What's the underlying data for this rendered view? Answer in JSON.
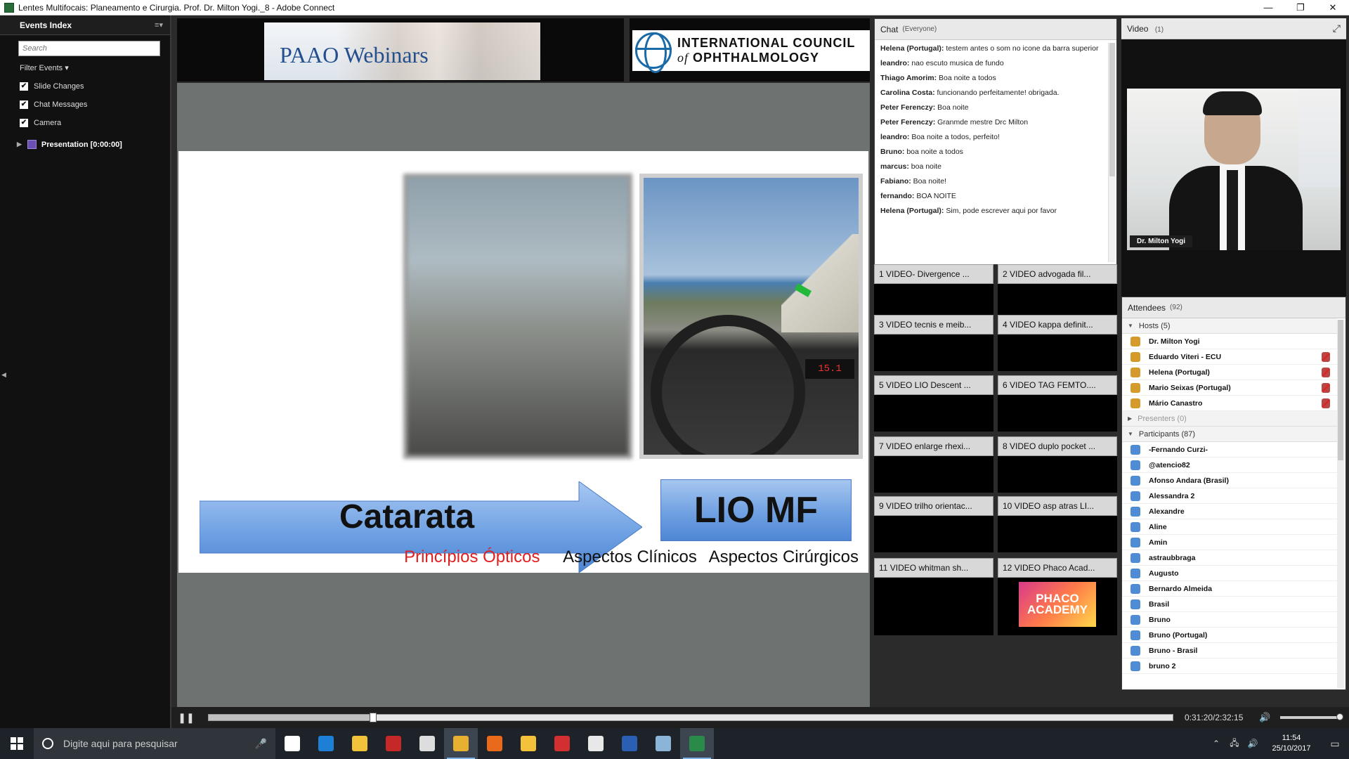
{
  "window": {
    "title": "Lentes Multifocais: Planeamento e Cirurgia. Prof. Dr. Milton Yogi._8 - Adobe Connect",
    "minimize": "—",
    "maximize": "❐",
    "close": "✕"
  },
  "events": {
    "title": "Events Index",
    "menu_icon": "≡▾",
    "search_placeholder": "Search",
    "filter_label": "Filter Events",
    "filter_caret": "▾",
    "checks": [
      "Slide Changes",
      "Chat Messages",
      "Camera"
    ],
    "check_mark": "✔",
    "tree_arrow": "▶",
    "presentation_label": "Presentation [0:00:00]",
    "collapse_arrow": "◀"
  },
  "logos": {
    "paao_text": "PAAO Webinars",
    "icoph_line1": "INTERNATIONAL COUNCIL",
    "icoph_of": "of",
    "icoph_line2": "OPHTHALMOLOGY"
  },
  "slide": {
    "dash_display": "15.1",
    "catarata": "Catarata",
    "lio": "LIO MF",
    "footer": {
      "optical": "Princípios Ópticos",
      "clinical": "Aspectos Clínicos",
      "surgical": "Aspectos Cirúrgicos"
    },
    "accent_red": "#e02020",
    "arrow_color": "#5b92dc"
  },
  "chat": {
    "title": "Chat",
    "scope": "(Everyone)",
    "messages": [
      {
        "from": "Helena (Portugal):",
        "text": "testem antes o som no icone da barra superior"
      },
      {
        "from": "leandro:",
        "text": "nao escuto musica de fundo"
      },
      {
        "from": "Thiago Amorim:",
        "text": "Boa noite a todos"
      },
      {
        "from": "Carolina Costa:",
        "text": "funcionando perfeitamente! obrigada."
      },
      {
        "from": "Peter Ferenczy:",
        "text": "Boa noite"
      },
      {
        "from": "Peter Ferenczy:",
        "text": "Granmde mestre Drc Milton"
      },
      {
        "from": "leandro:",
        "text": "Boa noite a todos, perfeito!"
      },
      {
        "from": "Bruno:",
        "text": "boa noite a todos"
      },
      {
        "from": "marcus:",
        "text": "boa noite"
      },
      {
        "from": "Fabiano:",
        "text": "Boa noite!"
      },
      {
        "from": "fernando:",
        "text": "BOA NOITE"
      },
      {
        "from": "Helena (Portugal):",
        "text": "Sim, pode escrever aqui por favor"
      }
    ]
  },
  "slots": [
    "1 VIDEO- Divergence ...",
    "2 VIDEO advogada fil...",
    "3 VIDEO tecnis e meib...",
    "4 VIDEO kappa definit...",
    "5 VIDEO LIO Descent ...",
    "6 VIDEO TAG FEMTO....",
    "7 VIDEO enlarge rhexi...",
    "8 VIDEO duplo pocket ...",
    "9 VIDEO trilho orientac...",
    "10 VIDEO asp atras LI...",
    "11 VIDEO whitman sh...",
    "12 VIDEO Phaco Acad..."
  ],
  "phaco_badge": "PHACO ACADEMY",
  "video": {
    "title": "Video",
    "count": "(1)",
    "fullscreen_icon": "⤢",
    "name_tag": "Dr. Milton Yogi"
  },
  "attendees": {
    "title": "Attendees",
    "count": "(92)",
    "hosts_label": "Hosts (5)",
    "hosts": [
      {
        "name": "Dr. Milton Yogi",
        "mic": false
      },
      {
        "name": "Eduardo Viteri - ECU",
        "mic": true
      },
      {
        "name": "Helena (Portugal)",
        "mic": true
      },
      {
        "name": "Mario Seixas (Portugal)",
        "mic": true
      },
      {
        "name": "Mário Canastro",
        "mic": true
      }
    ],
    "presenters_label": "Presenters (0)",
    "participants_label": "Participants (87)",
    "participants": [
      "-Fernando Curzi-",
      "@atencio82",
      "Afonso Andara (Brasil)",
      "Alessandra 2",
      "Alexandre",
      "Aline",
      "Amin",
      "astraubbraga",
      "Augusto",
      "Bernardo Almeida",
      "Brasil",
      "Bruno",
      "Bruno (Portugal)",
      "Bruno - Brasil",
      "bruno 2"
    ]
  },
  "playback": {
    "pause_icon": "❚❚",
    "time": "0:31:20/2:32:15",
    "progress_fraction": 0.1706,
    "volume_icon": "🔊",
    "volume_fraction": 0.95
  },
  "taskbar": {
    "search_placeholder": "Digite aqui para pesquisar",
    "mic_icon": "🎤",
    "tray_up": "⌃",
    "tray_net": "🖧",
    "tray_vol": "🔊",
    "clock_time": "11:54",
    "clock_date": "25/10/2017",
    "notif_icon": "▭",
    "apps": [
      {
        "name": "task-view",
        "color": "#ffffff",
        "active": false
      },
      {
        "name": "edge",
        "color": "#1e7fd6",
        "active": false
      },
      {
        "name": "file-explorer",
        "color": "#f2c23a",
        "active": false
      },
      {
        "name": "filezilla",
        "color": "#c62828",
        "active": false
      },
      {
        "name": "store",
        "color": "#dddddd",
        "active": false
      },
      {
        "name": "chrome",
        "color": "#e8b030",
        "active": true
      },
      {
        "name": "firefox",
        "color": "#e86a1a",
        "active": false
      },
      {
        "name": "outlook",
        "color": "#f3c23a",
        "active": false
      },
      {
        "name": "app-red",
        "color": "#d23030",
        "active": false
      },
      {
        "name": "itunes",
        "color": "#e8e8e8",
        "active": false
      },
      {
        "name": "word",
        "color": "#2b5fb4",
        "active": false
      },
      {
        "name": "paint",
        "color": "#8ab4d8",
        "active": false
      },
      {
        "name": "adobe-connect",
        "color": "#2a8a4a",
        "active": true
      }
    ]
  }
}
